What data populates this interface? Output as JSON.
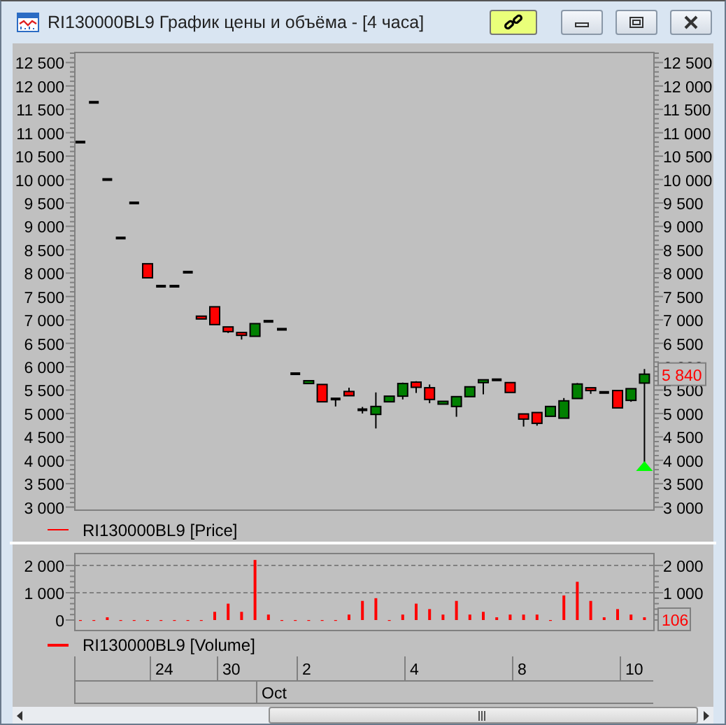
{
  "window": {
    "title": "RI130000BL9 График цены и объёма - [4 часа]",
    "link_active": true
  },
  "price_panel": {
    "legend": {
      "label": "RI130000BL9 [Price]",
      "color": "#ff0000"
    },
    "last_price": "5 840",
    "chart_data": {
      "type": "candlestick",
      "categories": [
        null,
        null,
        null,
        null,
        null,
        null,
        null,
        null,
        null,
        null,
        null,
        null,
        null,
        null,
        null,
        null,
        null,
        null,
        null,
        null,
        null,
        null,
        null,
        null,
        null,
        null,
        null,
        null,
        null,
        null,
        null,
        null,
        null,
        null,
        null,
        null,
        null,
        null,
        null,
        null,
        null,
        null,
        null
      ],
      "ohlc": [
        [
          10800,
          10800,
          10800,
          10800
        ],
        [
          11650,
          11650,
          11650,
          11650
        ],
        [
          10000,
          10000,
          10000,
          10000
        ],
        [
          8750,
          8750,
          8750,
          8750
        ],
        [
          9500,
          9500,
          9500,
          9500
        ],
        [
          8200,
          8200,
          7900,
          7900
        ],
        [
          7720,
          7720,
          7720,
          7720
        ],
        [
          7720,
          7720,
          7720,
          7720
        ],
        [
          8020,
          8020,
          8020,
          8020
        ],
        [
          7080,
          7080,
          7030,
          7030
        ],
        [
          7280,
          7280,
          6900,
          6900
        ],
        [
          6850,
          6850,
          6720,
          6750
        ],
        [
          6730,
          6730,
          6580,
          6680
        ],
        [
          6650,
          6920,
          6650,
          6920
        ],
        [
          6970,
          6970,
          6970,
          6970
        ],
        [
          6800,
          6800,
          6800,
          6800
        ],
        [
          5850,
          5850,
          5850,
          5850
        ],
        [
          5640,
          5700,
          5640,
          5700
        ],
        [
          5620,
          5620,
          5250,
          5250
        ],
        [
          5310,
          5310,
          5150,
          5290
        ],
        [
          5470,
          5550,
          5380,
          5380
        ],
        [
          5080,
          5140,
          5000,
          5060
        ],
        [
          4980,
          5450,
          4680,
          5150
        ],
        [
          5250,
          5370,
          5250,
          5370
        ],
        [
          5370,
          5660,
          5300,
          5640
        ],
        [
          5670,
          5690,
          5440,
          5560
        ],
        [
          5550,
          5620,
          5220,
          5300
        ],
        [
          5200,
          5260,
          5200,
          5260
        ],
        [
          5150,
          5360,
          4930,
          5360
        ],
        [
          5360,
          5570,
          5360,
          5570
        ],
        [
          5660,
          5720,
          5410,
          5720
        ],
        [
          5720,
          5720,
          5720,
          5720
        ],
        [
          5660,
          5660,
          5450,
          5450
        ],
        [
          4990,
          4990,
          4720,
          4880
        ],
        [
          5020,
          5020,
          4740,
          4790
        ],
        [
          4940,
          5150,
          4940,
          5150
        ],
        [
          4900,
          5330,
          4900,
          5270
        ],
        [
          5320,
          5650,
          5320,
          5630
        ],
        [
          5550,
          5550,
          5420,
          5490
        ],
        [
          5450,
          5450,
          5450,
          5450
        ],
        [
          5490,
          5490,
          5120,
          5120
        ],
        [
          5280,
          5530,
          5250,
          5530
        ],
        [
          5650,
          5950,
          3950,
          5840
        ]
      ],
      "ylim": [
        2934,
        12715
      ],
      "yticks": [
        {
          "value": 3000,
          "label": "3 000"
        },
        {
          "value": 3500,
          "label": "3 500"
        },
        {
          "value": 4000,
          "label": "4 000"
        },
        {
          "value": 4500,
          "label": "4 500"
        },
        {
          "value": 5000,
          "label": "5 000"
        },
        {
          "value": 5500,
          "label": "5 500"
        },
        {
          "value": 6000,
          "label": "6 000"
        },
        {
          "value": 6500,
          "label": "6 500"
        },
        {
          "value": 7000,
          "label": "7 000"
        },
        {
          "value": 7500,
          "label": "7 500"
        },
        {
          "value": 8000,
          "label": "8 000"
        },
        {
          "value": 8500,
          "label": "8 500"
        },
        {
          "value": 9000,
          "label": "9 000"
        },
        {
          "value": 9500,
          "label": "9 500"
        },
        {
          "value": 10000,
          "label": "10 000"
        },
        {
          "value": 10500,
          "label": "10 500"
        },
        {
          "value": 11000,
          "label": "11 000"
        },
        {
          "value": 11500,
          "label": "11 500"
        },
        {
          "value": 12000,
          "label": "12 000"
        },
        {
          "value": 12500,
          "label": "12 500"
        }
      ]
    }
  },
  "volume_panel": {
    "last_value": "106",
    "chart_data": {
      "type": "bar",
      "series": [
        {
          "name": "RI130000BL9 [Volume]",
          "color": "#ff0000",
          "values": [
            0,
            0,
            100,
            0,
            0,
            0,
            0,
            0,
            0,
            0,
            300,
            600,
            300,
            2200,
            200,
            0,
            0,
            0,
            0,
            0,
            200,
            700,
            800,
            0,
            200,
            600,
            400,
            200,
            700,
            200,
            300,
            100,
            200,
            200,
            200,
            0,
            900,
            1400,
            700,
            100,
            400,
            200,
            100
          ]
        }
      ],
      "ylim": [
        0,
        2460
      ],
      "yticks": [
        {
          "value": 0,
          "label": "0"
        },
        {
          "value": 1000,
          "label": "1 000"
        },
        {
          "value": 2000,
          "label": "2 000"
        }
      ]
    }
  },
  "time_axis": {
    "days": [
      "24",
      "30",
      "2",
      "4",
      "8",
      "10"
    ],
    "months": [
      "Oct"
    ]
  }
}
